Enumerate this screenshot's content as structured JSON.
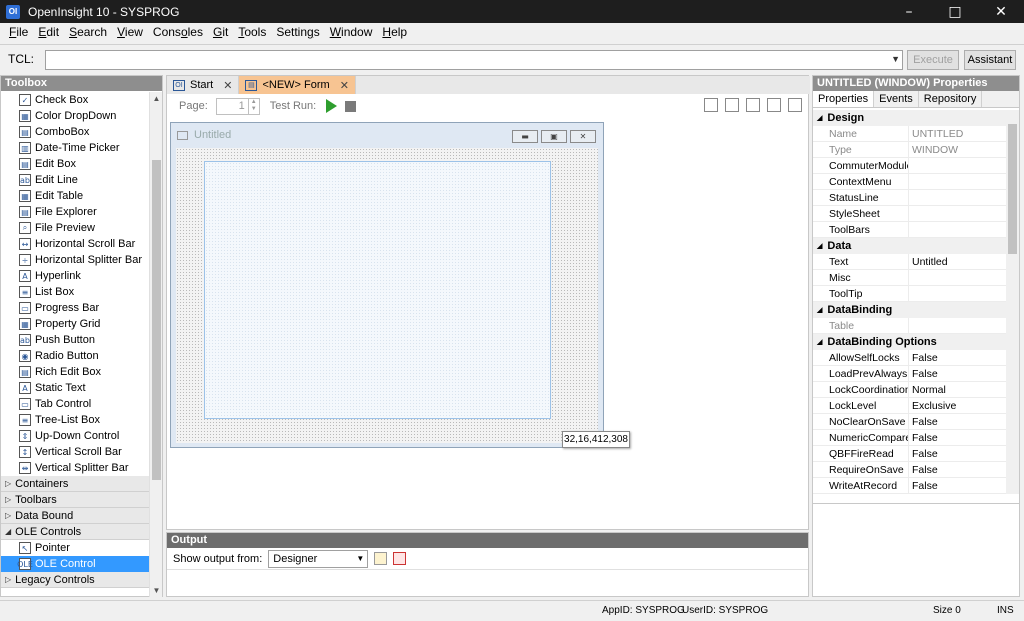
{
  "window": {
    "title": "OpenInsight 10 - SYSPROG",
    "app_icon": "OI"
  },
  "menu": [
    {
      "pre": "",
      "u": "F",
      "post": "ile"
    },
    {
      "pre": "",
      "u": "E",
      "post": "dit"
    },
    {
      "pre": "",
      "u": "S",
      "post": "earch"
    },
    {
      "pre": "",
      "u": "V",
      "post": "iew"
    },
    {
      "pre": "Cons",
      "u": "o",
      "post": "les"
    },
    {
      "pre": "",
      "u": "G",
      "post": "it"
    },
    {
      "pre": "",
      "u": "T",
      "post": "ools"
    },
    {
      "pre": "Settin",
      "u": "g",
      "post": "s"
    },
    {
      "pre": "",
      "u": "W",
      "post": "indow"
    },
    {
      "pre": "",
      "u": "H",
      "post": "elp"
    }
  ],
  "tcl": {
    "label": "TCL:",
    "value": "",
    "execute_label": "Execute",
    "assistant_label": "Assistant"
  },
  "toolbox": {
    "title": "Toolbox",
    "items": [
      {
        "label": "Check Box",
        "icon": "✓"
      },
      {
        "label": "Color DropDown",
        "icon": "▦"
      },
      {
        "label": "ComboBox",
        "icon": "▤"
      },
      {
        "label": "Date-Time Picker",
        "icon": "▥"
      },
      {
        "label": "Edit Box",
        "icon": "▤"
      },
      {
        "label": "Edit Line",
        "icon": "ab"
      },
      {
        "label": "Edit Table",
        "icon": "▦"
      },
      {
        "label": "File Explorer",
        "icon": "▤"
      },
      {
        "label": "File Preview",
        "icon": "⌕"
      },
      {
        "label": "Horizontal Scroll Bar",
        "icon": "↔"
      },
      {
        "label": "Horizontal Splitter Bar",
        "icon": "÷"
      },
      {
        "label": "Hyperlink",
        "icon": "A"
      },
      {
        "label": "List Box",
        "icon": "≡"
      },
      {
        "label": "Progress Bar",
        "icon": "▭"
      },
      {
        "label": "Property Grid",
        "icon": "▦"
      },
      {
        "label": "Push Button",
        "icon": "ab"
      },
      {
        "label": "Radio Button",
        "icon": "◉"
      },
      {
        "label": "Rich Edit Box",
        "icon": "▤"
      },
      {
        "label": "Static Text",
        "icon": "A"
      },
      {
        "label": "Tab Control",
        "icon": "▭"
      },
      {
        "label": "Tree-List Box",
        "icon": "≡"
      },
      {
        "label": "Up-Down Control",
        "icon": "⇕"
      },
      {
        "label": "Vertical Scroll Bar",
        "icon": "↕"
      },
      {
        "label": "Vertical Splitter Bar",
        "icon": "⇹"
      }
    ],
    "groups_top": [
      {
        "label": "Containers",
        "expanded": false
      },
      {
        "label": "Toolbars",
        "expanded": false
      },
      {
        "label": "Data Bound",
        "expanded": false
      },
      {
        "label": "OLE Controls",
        "expanded": true
      }
    ],
    "ole_items": [
      {
        "label": "Pointer",
        "icon": "↖",
        "selected": false
      },
      {
        "label": "OLE Control",
        "icon": "OLE",
        "selected": true
      }
    ],
    "groups_bottom": [
      {
        "label": "Legacy Controls",
        "expanded": false
      }
    ]
  },
  "tabs": [
    {
      "label": "Start",
      "icon": "OI",
      "active": false
    },
    {
      "label": "<NEW> Form",
      "icon": "▤",
      "active": true
    }
  ],
  "designer": {
    "page_label": "Page:",
    "page_value": "1",
    "test_run_label": "Test Run:"
  },
  "form": {
    "title": "Untitled",
    "coords": "32,16,412,308"
  },
  "output": {
    "title": "Output",
    "show_from_label": "Show output from:",
    "selected": "Designer"
  },
  "properties": {
    "title": "UNTITLED (WINDOW) Properties",
    "tabs": [
      "Properties",
      "Events",
      "Repository"
    ],
    "categories": [
      {
        "name": "Design",
        "rows": [
          {
            "name": "Name",
            "value": "UNTITLED",
            "dim": true
          },
          {
            "name": "Type",
            "value": "WINDOW",
            "dim": true
          },
          {
            "name": "CommuterModule",
            "value": "",
            "dim": false
          },
          {
            "name": "ContextMenu",
            "value": "",
            "dim": false
          },
          {
            "name": "StatusLine",
            "value": "",
            "dim": false
          },
          {
            "name": "StyleSheet",
            "value": "",
            "dim": false
          },
          {
            "name": "ToolBars",
            "value": "",
            "dim": false
          }
        ]
      },
      {
        "name": "Data",
        "rows": [
          {
            "name": "Text",
            "value": "Untitled",
            "dim": false
          },
          {
            "name": "Misc",
            "value": "",
            "dim": false
          },
          {
            "name": "ToolTip",
            "value": "",
            "dim": false
          }
        ]
      },
      {
        "name": "DataBinding",
        "rows": [
          {
            "name": "Table",
            "value": "",
            "dim": true
          }
        ]
      },
      {
        "name": "DataBinding Options",
        "rows": [
          {
            "name": "AllowSelfLocks",
            "value": "False",
            "dim": false
          },
          {
            "name": "LoadPrevAlways",
            "value": "False",
            "dim": false
          },
          {
            "name": "LockCoordination",
            "value": "Normal",
            "dim": false
          },
          {
            "name": "LockLevel",
            "value": "Exclusive",
            "dim": false
          },
          {
            "name": "NoClearOnSave",
            "value": "False",
            "dim": false
          },
          {
            "name": "NumericCompare",
            "value": "False",
            "dim": false
          },
          {
            "name": "QBFFireRead",
            "value": "False",
            "dim": false
          },
          {
            "name": "RequireOnSave",
            "value": "False",
            "dim": false
          },
          {
            "name": "WriteAtRecord",
            "value": "False",
            "dim": false
          }
        ]
      }
    ]
  },
  "status": {
    "appid": "AppID: SYSPROG",
    "userid": "UserID: SYSPROG",
    "size": "Size 0",
    "mode": "INS"
  }
}
